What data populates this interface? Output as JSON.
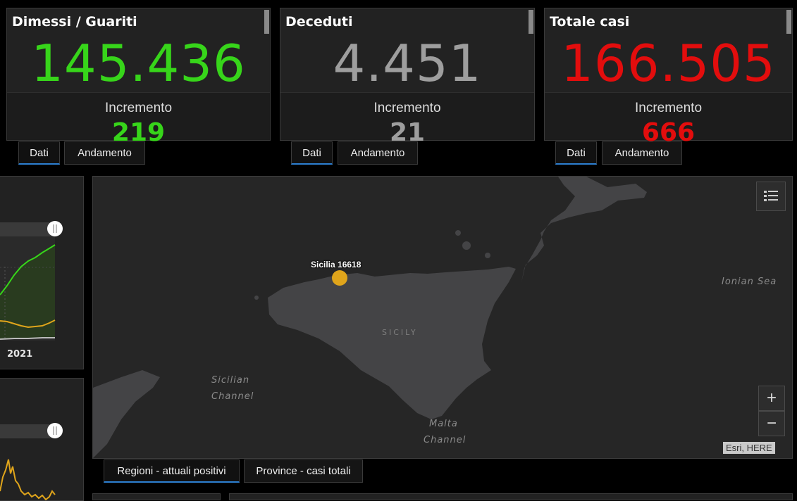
{
  "cards": [
    {
      "title": "Dimessi / Guariti",
      "value": "145.436",
      "increment_label": "Incremento",
      "increment": "219",
      "color": "#37d51a"
    },
    {
      "title": "Deceduti",
      "value": "4.451",
      "increment_label": "Incremento",
      "increment": "21",
      "color": "#9e9e9e"
    },
    {
      "title": "Totale casi",
      "value": "166.505",
      "increment_label": "Incremento",
      "increment": "666",
      "color": "#e30d0d"
    }
  ],
  "card_tabs": {
    "dati": "Dati",
    "andamento": "Andamento"
  },
  "left_chart": {
    "year_label": "2021"
  },
  "map": {
    "marker_label": "Sicilia 16618",
    "place_labels": {
      "sicily": "SICILY",
      "ionian": "Ionian Sea",
      "sicilian_channel_1": "Sicilian",
      "sicilian_channel_2": "Channel",
      "malta_1": "Malta",
      "malta_2": "Channel"
    },
    "attribution": "Esri, HERE",
    "zoom_in": "+",
    "zoom_out": "−"
  },
  "map_tabs": {
    "regioni": "Regioni - attuali positivi",
    "province": "Province - casi totali"
  },
  "colors": {
    "accent": "#2d7fd1",
    "marker": "#e0a51b",
    "land": "#444446",
    "sea": "#262626"
  }
}
